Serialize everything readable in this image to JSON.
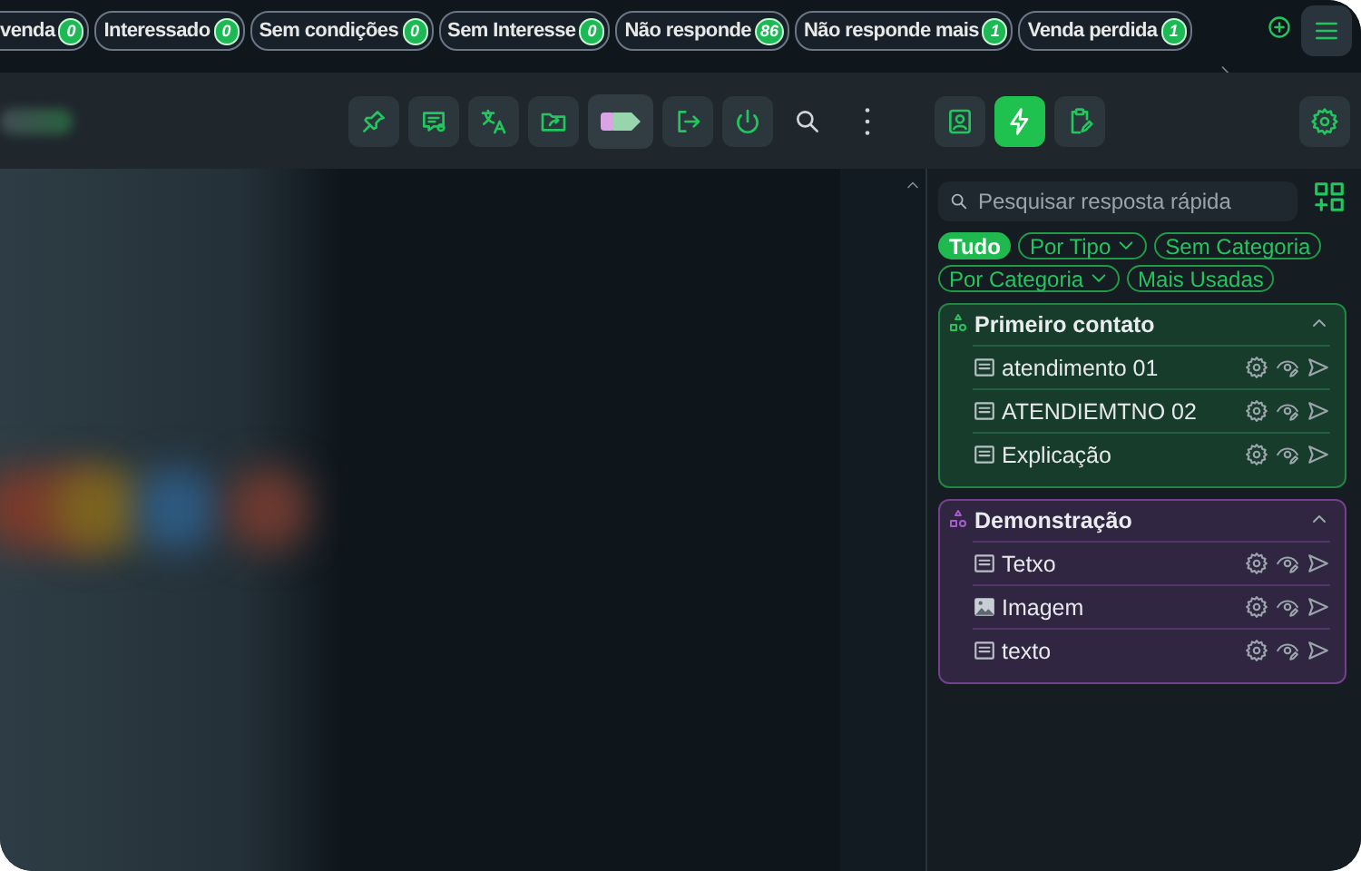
{
  "status_tabs": [
    {
      "label": "venda",
      "count": "0"
    },
    {
      "label": "Interessado",
      "count": "0"
    },
    {
      "label": "Sem condições",
      "count": "0"
    },
    {
      "label": "Sem Interesse",
      "count": "0"
    },
    {
      "label": "Não responde",
      "count": "86"
    },
    {
      "label": "Não responde mais",
      "count": "1"
    },
    {
      "label": "Venda perdida",
      "count": "1"
    }
  ],
  "panel_tabs": [
    {
      "kind": "contact",
      "selected": false
    },
    {
      "kind": "lightning",
      "selected": true
    },
    {
      "kind": "clipboard",
      "selected": false
    }
  ],
  "quick_replies": {
    "search": {
      "placeholder": "Pesquisar resposta rápida"
    },
    "filters": [
      {
        "label": "Tudo",
        "selected": true,
        "dropdown": false
      },
      {
        "label": "Por Tipo",
        "selected": false,
        "dropdown": true
      },
      {
        "label": "Sem Categoria",
        "selected": false,
        "dropdown": false
      },
      {
        "label": "Por Categoria",
        "selected": false,
        "dropdown": true
      },
      {
        "label": "Mais Usadas",
        "selected": false,
        "dropdown": false
      }
    ],
    "groups": [
      {
        "title": "Primeiro contato",
        "color": "#2fbf5f",
        "expanded": true,
        "items": [
          {
            "kind": "text",
            "label": "atendimento 01"
          },
          {
            "kind": "text",
            "label": "ATENDIEMTNO 02"
          },
          {
            "kind": "text",
            "label": "Explicação"
          }
        ]
      },
      {
        "title": "Demonstração",
        "color": "#a45cc8",
        "expanded": true,
        "items": [
          {
            "kind": "text",
            "label": "Tetxo"
          },
          {
            "kind": "image",
            "label": "Imagem"
          },
          {
            "kind": "text",
            "label": "texto"
          }
        ]
      }
    ]
  }
}
